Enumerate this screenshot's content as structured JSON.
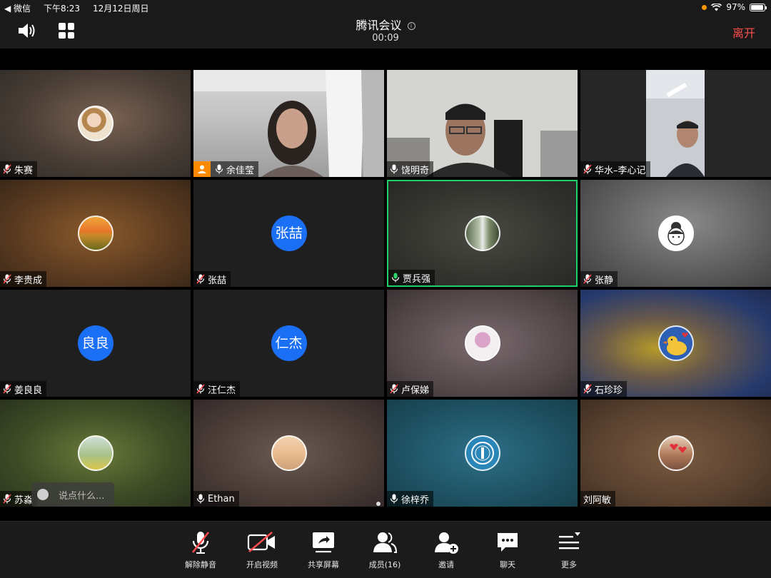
{
  "statusbar": {
    "back_app": "◀ 微信",
    "time": "下午8:23",
    "date": "12月12日周日",
    "battery": "97%"
  },
  "header": {
    "title": "腾讯会议",
    "info_icon": "info-icon",
    "timer": "00:09",
    "leave_label": "离开"
  },
  "tiles": [
    {
      "name": "朱赛",
      "mic": "muted",
      "avatar": "photo-child"
    },
    {
      "name": "余佳莹",
      "mic": "on",
      "video": "woman-video",
      "host": true
    },
    {
      "name": "饶明奇",
      "mic": "on",
      "video": "man-glasses-video"
    },
    {
      "name": "华水–李心记",
      "mic": "muted",
      "video": "man-office-video"
    },
    {
      "name": "李贵成",
      "mic": "muted",
      "avatar": "photo-sunset"
    },
    {
      "name": "张喆",
      "mic": "muted",
      "initials": "张喆"
    },
    {
      "name": "贾兵强",
      "mic": "speaking",
      "avatar": "photo-waterfall",
      "active": true
    },
    {
      "name": "张静",
      "mic": "muted",
      "avatar": "photo-cartoon-girl"
    },
    {
      "name": "姜良良",
      "mic": "muted",
      "initials": "良良"
    },
    {
      "name": "汪仁杰",
      "mic": "muted",
      "initials": "仁杰"
    },
    {
      "name": "卢保娣",
      "mic": "muted",
      "avatar": "photo-flowers"
    },
    {
      "name": "石珍珍",
      "mic": "muted",
      "avatar": "photo-duck-cartoon"
    },
    {
      "name": "苏淼",
      "mic": "muted",
      "avatar": "photo-girl-field"
    },
    {
      "name": "Ethan",
      "mic": "on",
      "avatar": "photo-beach-person"
    },
    {
      "name": "徐梓乔",
      "mic": "on",
      "avatar": "photo-emblem"
    },
    {
      "name": "刘阿敏",
      "mic": "none",
      "avatar": "photo-couple-hearts"
    }
  ],
  "chat": {
    "placeholder": "说点什么..."
  },
  "toolbar": {
    "unmute": "解除静音",
    "video": "开启视频",
    "share": "共享屏幕",
    "members": "成员(16)",
    "invite": "邀请",
    "chat": "聊天",
    "more": "更多"
  },
  "colors": {
    "leave": "#ff4d4f",
    "active_border": "#1fd068",
    "initials_bg": "#1a6ff5",
    "host_badge": "#ff8a00",
    "muted": "#ff4d4f"
  }
}
